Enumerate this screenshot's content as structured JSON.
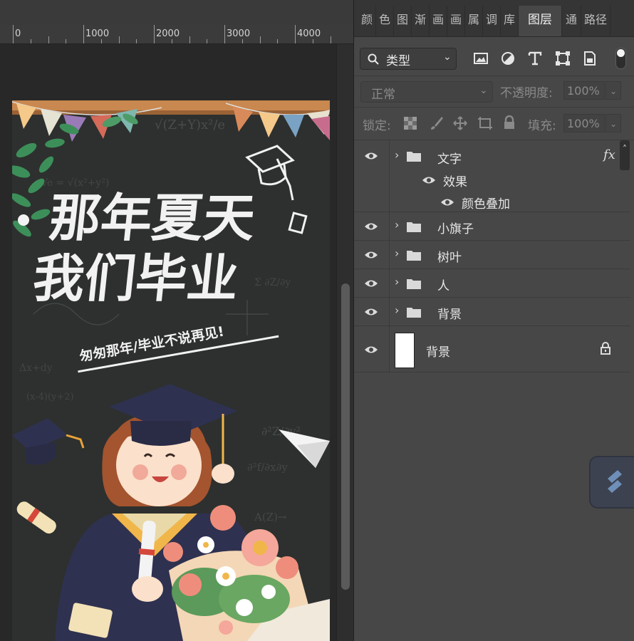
{
  "ruler": {
    "labels": [
      "0",
      "1000",
      "2000",
      "3000",
      "4000"
    ]
  },
  "poster": {
    "headline_line1": "那年夏天",
    "headline_line2": "我们毕业",
    "subtitle": "匆匆那年/毕业不说再见!",
    "colors": {
      "board": "#2e312f",
      "chalk": "#f2f2f2",
      "gown": "#2f3150",
      "gold": "#f1b64a",
      "hair": "#a4542e"
    }
  },
  "tabs": [
    {
      "label": "颜",
      "active": false
    },
    {
      "label": "色",
      "active": false
    },
    {
      "label": "图",
      "active": false
    },
    {
      "label": "渐",
      "active": false
    },
    {
      "label": "画",
      "active": false
    },
    {
      "label": "画",
      "active": false
    },
    {
      "label": "属",
      "active": false
    },
    {
      "label": "调",
      "active": false
    },
    {
      "label": "库",
      "active": false
    },
    {
      "label": "图层",
      "active": true
    },
    {
      "label": "通",
      "active": false
    },
    {
      "label": "路径",
      "active": false
    }
  ],
  "layers_panel": {
    "filter_select": {
      "value": "类型",
      "icon": "search-icon"
    },
    "filter_icons": [
      "pixel-filter-icon",
      "adjustment-filter-icon",
      "type-filter-icon",
      "shape-filter-icon",
      "smart-object-filter-icon"
    ],
    "blend_mode": "正常",
    "opacity_label": "不透明度:",
    "opacity_value": "100%",
    "lock_label": "锁定:",
    "fill_label": "填充:",
    "fill_value": "100%",
    "fx_label": "fx",
    "layers": [
      {
        "name": "文字",
        "type": "group",
        "visible": true,
        "has_effects": true
      },
      {
        "name": "效果",
        "type": "effects",
        "visible": true
      },
      {
        "name": "颜色叠加",
        "type": "effect-item",
        "visible": true
      },
      {
        "name": "小旗子",
        "type": "group",
        "visible": true
      },
      {
        "name": "树叶",
        "type": "group",
        "visible": true
      },
      {
        "name": "人",
        "type": "group",
        "visible": true
      },
      {
        "name": "背景",
        "type": "group",
        "visible": true
      },
      {
        "name": "背景",
        "type": "pixel",
        "visible": true,
        "locked": true
      }
    ]
  }
}
